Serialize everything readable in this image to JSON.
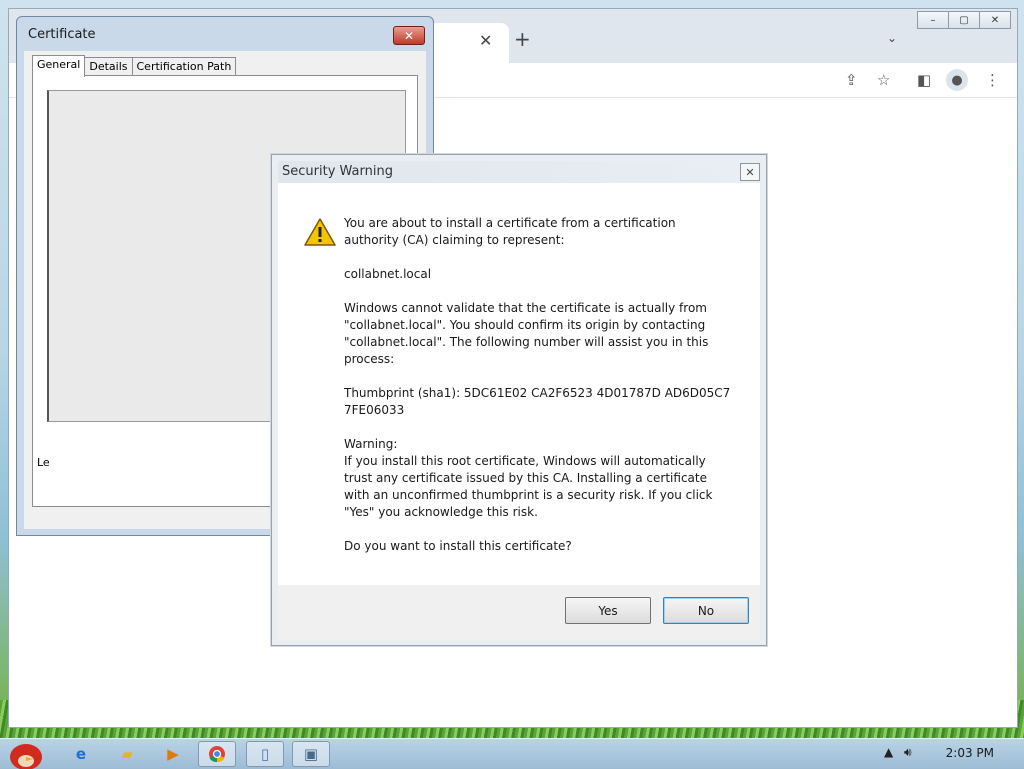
{
  "certificate_window": {
    "title": "Certificate",
    "tabs": [
      "General",
      "Details",
      "Certification Path"
    ],
    "partial_label": "Le"
  },
  "security_dialog": {
    "title": "Security Warning",
    "paragraphs": [
      "You are about to install a certificate from a certification authority (CA) claiming to represent:",
      "collabnet.local",
      "Windows cannot validate that the certificate is actually from \"collabnet.local\". You should confirm its origin by contacting \"collabnet.local\". The following number will assist you in this process:",
      "Thumbprint (sha1): 5DC61E02 CA2F6523 4D01787D AD6D05C7 7FE06033",
      "Warning:\nIf you install this root certificate, Windows will automatically trust any certificate issued by this CA. Installing a certificate with an unconfirmed thumbprint is a security risk. If you click \"Yes\" you acknowledge this risk.",
      "Do you want to install this certificate?"
    ],
    "yes_label": "Yes",
    "no_label": "No",
    "icon": "warning-icon"
  },
  "browser": {
    "tab_close": "✕",
    "new_tab": "+",
    "tab_menu": "⌄",
    "window_buttons": [
      "–",
      "▢",
      "✕"
    ],
    "toolbar_icons": [
      "share-icon",
      "star-icon",
      "sidebar-icon",
      "profile-icon",
      "menu-icon"
    ]
  },
  "taskbar": {
    "apps": [
      "angry-birds-icon",
      "internet-explorer-icon",
      "folder-icon",
      "media-player-icon",
      "chrome-icon",
      "notepad-icon",
      "window-icon"
    ],
    "clock": "2:03 PM"
  },
  "colors": {
    "dialog_bg": "#e9eef3",
    "close_red": "#c0392b",
    "default_button_border": "#3c7fb1"
  }
}
